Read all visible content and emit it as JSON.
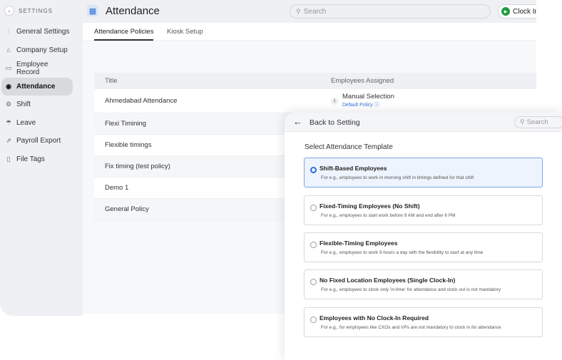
{
  "sidebar": {
    "title": "SETTINGS",
    "items": [
      {
        "label": "General Settings",
        "icon": "sliders-icon",
        "glyph": "⫶"
      },
      {
        "label": "Company Setup",
        "icon": "building-icon",
        "glyph": "⌂"
      },
      {
        "label": "Employee Record",
        "icon": "id-card-icon",
        "glyph": "▭"
      },
      {
        "label": "Attendance",
        "icon": "attendance-icon",
        "glyph": "◉"
      },
      {
        "label": "Shift",
        "icon": "shift-icon",
        "glyph": "⚙"
      },
      {
        "label": "Leave",
        "icon": "leave-icon",
        "glyph": "☂"
      },
      {
        "label": "Payroll Export",
        "icon": "export-icon",
        "glyph": "⇗"
      },
      {
        "label": "File Tags",
        "icon": "tag-icon",
        "glyph": "▯"
      }
    ]
  },
  "header": {
    "title": "Attendance",
    "search_placeholder": "Search",
    "clock_in": "Clock In"
  },
  "tabs": [
    {
      "label": "Attendance Policies"
    },
    {
      "label": "Kiosk Setup"
    }
  ],
  "table": {
    "columns": [
      "Title",
      "Employees Assigned"
    ],
    "rows": [
      {
        "title": "Ahmedabad Attendance",
        "count": "1",
        "assigned": "Manual Selection",
        "sub": "Default Policy ⓘ"
      },
      {
        "title": "Flexi Timining"
      },
      {
        "title": "Flexible timings"
      },
      {
        "title": "Fix timing (test policy)"
      },
      {
        "title": "Demo 1"
      },
      {
        "title": "General Policy"
      }
    ]
  },
  "panel": {
    "back_label": "Back to Setting",
    "search_placeholder": "Search",
    "title": "Select Attendance Template",
    "options": [
      {
        "title": "Shift-Based Employees",
        "desc": "For e.g., employees to work in morning shift in timings defined for that shift",
        "selected": true
      },
      {
        "title": "Fixed-Timing Employees (No Shift)",
        "desc": "For e.g., employees to start work before 9 AM and end after 6 PM",
        "selected": false
      },
      {
        "title": "Flexible-Timing Employees",
        "desc": "For e.g., employees to work 9 hours a day with the flexibility to start at any time",
        "selected": false
      },
      {
        "title": "No Fixed Location Employees (Single Clock-In)",
        "desc": "For e.g., employees to clock only 'in-time' for attendance and clock out is not mandatory",
        "selected": false
      },
      {
        "title": "Employees with No Clock-In Required",
        "desc": "For e.g., for employees like CXOs and VPs are not mandatory to clock in for attendance",
        "selected": false
      }
    ]
  }
}
